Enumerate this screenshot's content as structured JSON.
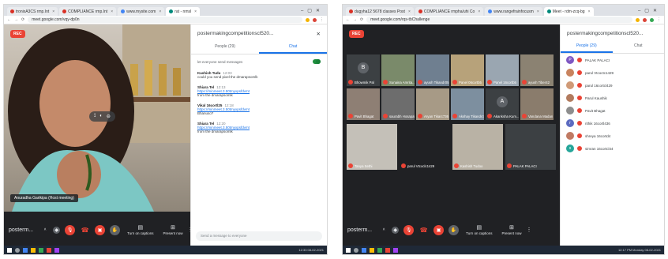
{
  "left": {
    "tabs": [
      "tronixA3CS rmp.Int",
      "COMPLIANCE rmp.Int",
      "www.mysite.com",
      "rat - nmsl"
    ],
    "url": "meet.google.com/vqy-dp0n",
    "rec": "REC",
    "speaker_name": "Anuradha Garikipa (Host meeting)",
    "meet_code": "posterm...",
    "btn_captions": "Turn on captions",
    "btn_present": "Present now",
    "panel_title": "postermakingcompetitionscl520...",
    "tab_people": "People (29)",
    "tab_chat": "Chat",
    "toggle_label": "let everyone send messages",
    "messages": [
      {
        "who": "Kashish Tudu",
        "time": "12:03",
        "text": "could you send pixel the dmarapsomlk"
      },
      {
        "who": "Shiara Tel",
        "time": "12:13",
        "link": "https://minmeet.3.50tmyxpsfdvmt",
        "text": "from the dmarapsomlk"
      },
      {
        "who": "Vikal 16cortl25",
        "time": "12:18",
        "link": "https://minmeet.3.50tmyxpsfdvmt",
        "text": "Bhanuso?"
      },
      {
        "who": "Shiara Tel",
        "time": "12:20",
        "link": "https://minmeet.3.50tmyxpsfdvmt",
        "text": "from the dmarapsomlk"
      }
    ],
    "chat_placeholder": "Send a message to everyone",
    "clock": "12:33 08-02-2021"
  },
  "right": {
    "tabs": [
      "dugyha12 5678 classes Post",
      "COMPLIANCE rmpha/uhi Co",
      "www.rangefrainfocusm",
      "Meet - rdm-zcq-bg"
    ],
    "url": "meet.google.com/rqs-tbChallenge",
    "rec": "REC",
    "meet_code": "posterm...",
    "btn_captions": "Turn on captions",
    "btn_present": "Present now",
    "panel_title": "postermakingcompetitionscl520...",
    "tab_people": "People (29)",
    "tab_chat": "Chat",
    "tiles": [
      {
        "name": "Bhowmik Pal",
        "initial": "B"
      },
      {
        "name": "Sunaina Amrita...",
        "initial": ""
      },
      {
        "name": "ayush Tikandr05",
        "initial": ""
      },
      {
        "name": "Panel 06cortb5",
        "initial": ""
      },
      {
        "name": "Panel 16cortb5",
        "initial": ""
      },
      {
        "name": "ayush Tiber42",
        "initial": ""
      },
      {
        "name": "Pavit Bhagat",
        "initial": ""
      },
      {
        "name": "saurabh Hosapal",
        "initial": ""
      },
      {
        "name": "Aryan Tikarc736",
        "initial": ""
      },
      {
        "name": "Akshay Tikandrc57",
        "initial": ""
      },
      {
        "name": "Akanksha Kum...",
        "initial": "A"
      },
      {
        "name": "Vandana Madan",
        "initial": ""
      },
      {
        "name": "Tanya Sethi",
        "initial": ""
      },
      {
        "name": "parul Vtcoclc1429",
        "initial": ""
      },
      {
        "name": "Kashish Tudoo",
        "initial": ""
      },
      {
        "name": "PALAK PALACI",
        "initial": ""
      }
    ],
    "people": [
      {
        "name": "PALAK PALACI",
        "initial": "P",
        "color": "#7e57c2"
      },
      {
        "name": "parul Vtcoctc1429",
        "initial": "",
        "color": "#c9835e"
      },
      {
        "name": "parul 16cortcl429",
        "initial": "",
        "color": "#d09a77"
      },
      {
        "name": "Parul Kaushik",
        "initial": "",
        "color": "#b27b5e"
      },
      {
        "name": "Pavit Bhagat",
        "initial": "",
        "color": "#8d8d8d"
      },
      {
        "name": "rithik 16cortl436",
        "initial": "r",
        "color": "#5c6bc0"
      },
      {
        "name": "shreya 16cortd4",
        "initial": "",
        "color": "#c07a63"
      },
      {
        "name": "simran 16cortcl44",
        "initial": "s",
        "color": "#26a69a"
      }
    ],
    "clock": "12:17 PM Monday 08-02-2021"
  }
}
